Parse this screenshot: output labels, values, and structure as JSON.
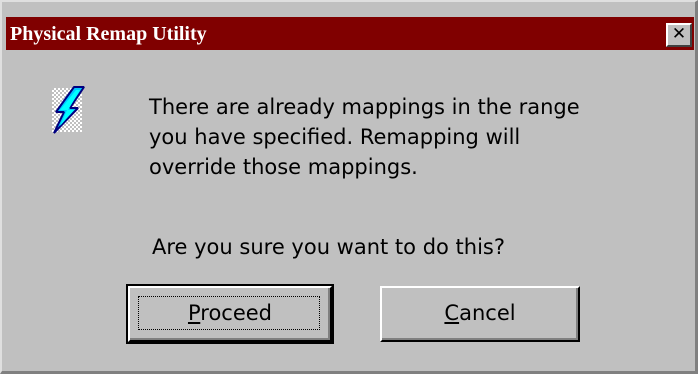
{
  "window": {
    "title": "Physical Remap Utility",
    "close_glyph": "✕",
    "title_bar_color": "#800000",
    "body_color": "#c0c0c0"
  },
  "icon": {
    "name": "lightning-bolt-icon"
  },
  "message": {
    "text": "There are already mappings in the range\nyou have specified. Remapping will\noverride those mappings.",
    "question": "Are you sure you want to do this?"
  },
  "buttons": {
    "proceed": {
      "mnemonic": "P",
      "rest": "roceed",
      "default": true
    },
    "cancel": {
      "mnemonic": "C",
      "rest": "ancel",
      "default": false
    }
  }
}
